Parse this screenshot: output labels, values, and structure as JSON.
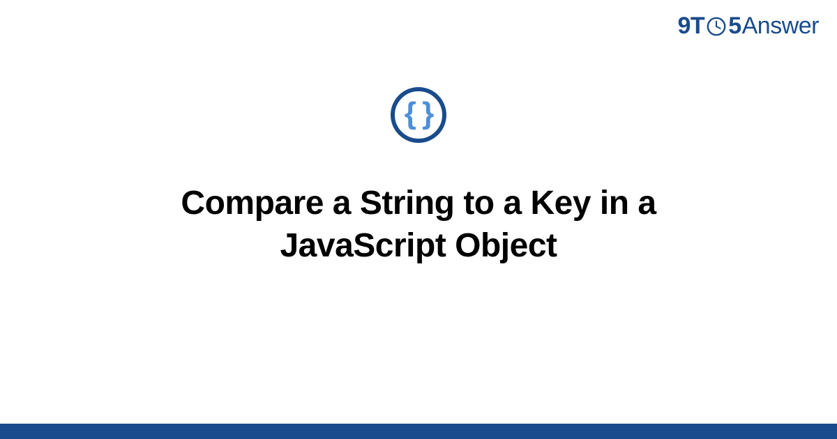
{
  "brand": {
    "prefix_9": "9",
    "prefix_T": "T",
    "suffix_5": "5",
    "suffix_answer": "Answer"
  },
  "category": {
    "icon_glyph": "{ }"
  },
  "main": {
    "title": "Compare a String to a Key in a JavaScript Object"
  },
  "colors": {
    "brand_blue": "#1a4b8c",
    "accent_blue": "#4d8fd6"
  }
}
